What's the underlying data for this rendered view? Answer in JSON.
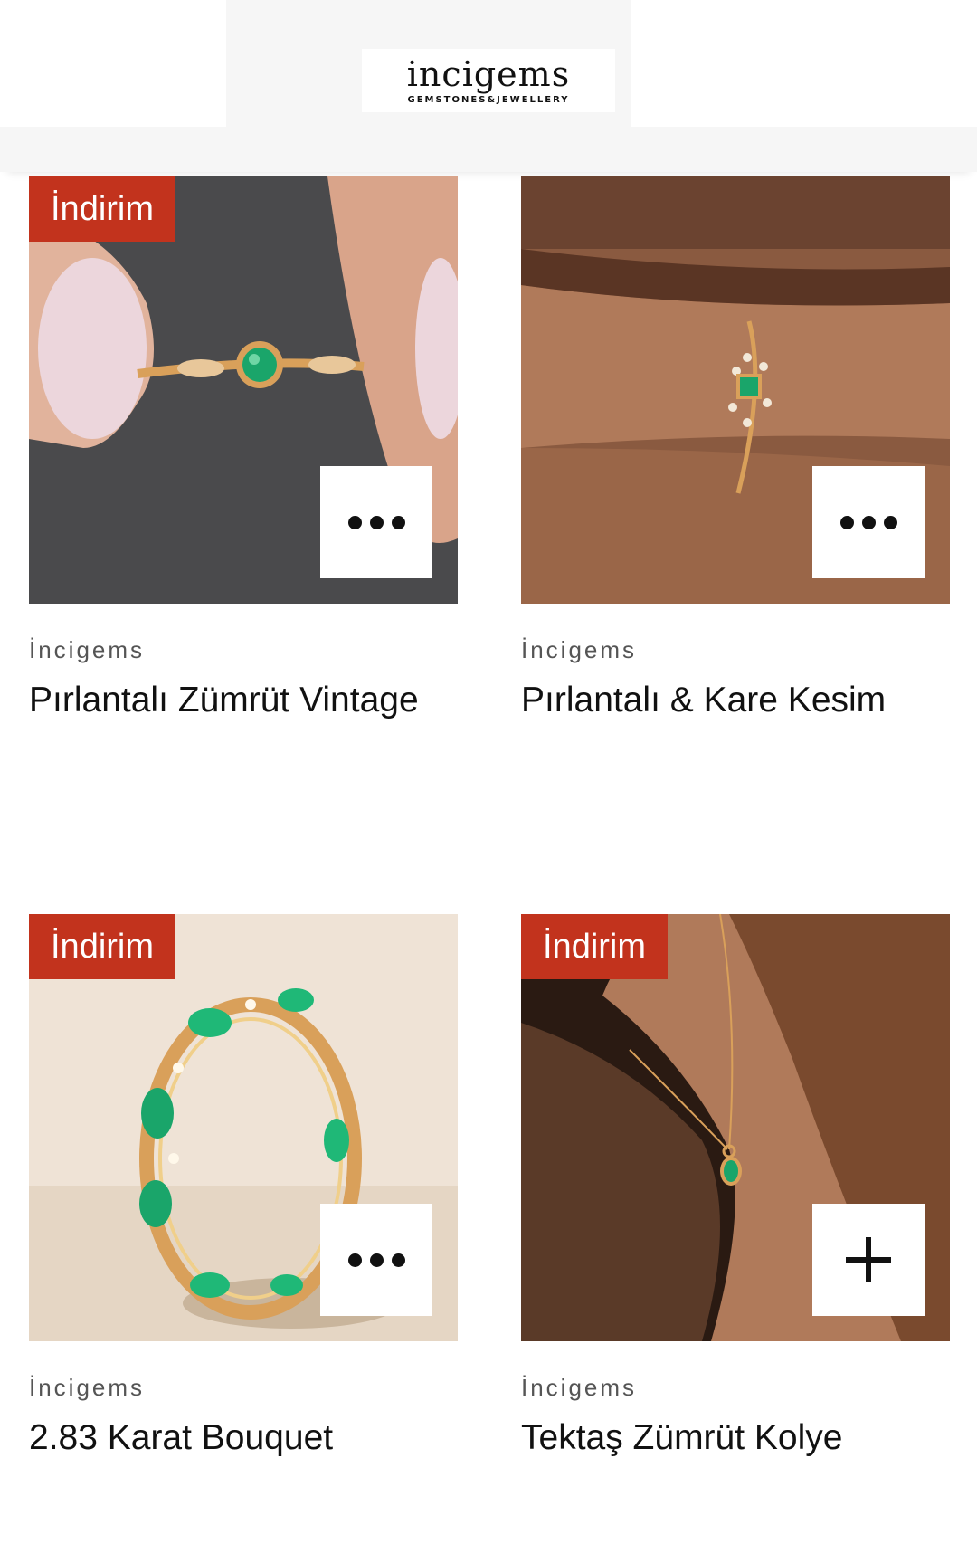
{
  "header": {
    "logo_word": "incigems",
    "logo_sub": "GEMSTONES&JEWELLERY"
  },
  "colors": {
    "badge": "#c2331d",
    "header_bg": "#f6f6f6",
    "gem": "#1aa56a",
    "gold": "#d9a05a"
  },
  "products": [
    {
      "badge": "İndirim",
      "vendor": "İncigems",
      "title": "Pırlantalı Zümrüt Vintage",
      "action_icon": "more-dots-icon"
    },
    {
      "badge": "",
      "vendor": "İncigems",
      "title": "Pırlantalı & Kare Kesim",
      "action_icon": "more-dots-icon"
    },
    {
      "badge": "İndirim",
      "vendor": "İncigems",
      "title": "2.83 Karat Bouquet",
      "action_icon": "more-dots-icon"
    },
    {
      "badge": "İndirim",
      "vendor": "İncigems",
      "title": "Tektaş Zümrüt Kolye",
      "action_icon": "plus-icon"
    }
  ]
}
